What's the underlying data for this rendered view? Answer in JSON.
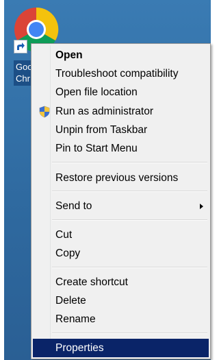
{
  "desktop": {
    "shortcut_label_line1": "Goo",
    "shortcut_label_line2": "Chr"
  },
  "menu": {
    "items": [
      {
        "label": "Open",
        "bold": true
      },
      {
        "label": "Troubleshoot compatibility"
      },
      {
        "label": "Open file location"
      },
      {
        "label": "Run as administrator",
        "icon": "shield-icon"
      },
      {
        "label": "Unpin from Taskbar"
      },
      {
        "label": "Pin to Start Menu"
      },
      {
        "label": "Restore previous versions"
      },
      {
        "label": "Send to",
        "submenu": true
      },
      {
        "label": "Cut"
      },
      {
        "label": "Copy"
      },
      {
        "label": "Create shortcut"
      },
      {
        "label": "Delete"
      },
      {
        "label": "Rename"
      },
      {
        "label": "Properties",
        "selected": true
      }
    ]
  },
  "colors": {
    "desktop": "#2f6aa0",
    "menu_bg": "#f0f0f0",
    "selection": "#0a2468"
  }
}
